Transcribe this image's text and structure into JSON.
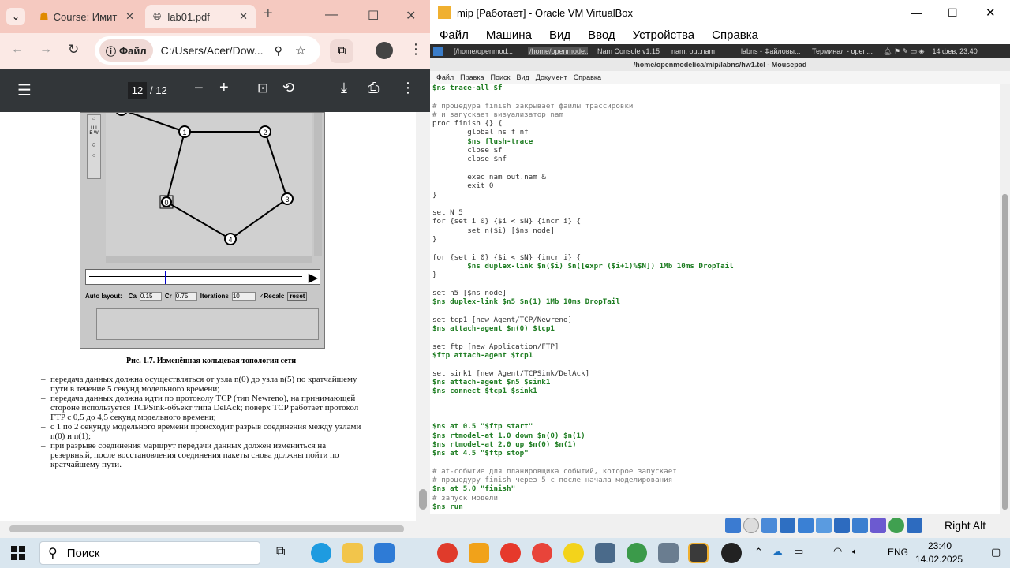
{
  "chrome": {
    "tabs": [
      {
        "label": "Course: Имит"
      },
      {
        "label": "lab01.pdf"
      }
    ],
    "new_tab": "+",
    "win_min": "—",
    "win_max": "☐",
    "win_close": "✕",
    "chip_label": "Файл",
    "url": "C:/Users/Acer/Dow...",
    "pdf": {
      "page_current": "12",
      "page_total": "/ 12"
    }
  },
  "pdf": {
    "nam_labels": {
      "autolayout": "Auto layout:",
      "ca": "Ca",
      "ca_val": "0.15",
      "cr": "Cr",
      "cr_val": "0.75",
      "iter": "Iterations",
      "iter_val": "10",
      "recalc": "✓Recalc",
      "reset": "reset"
    },
    "nodes": [
      "1",
      "2",
      "3",
      "4",
      "0"
    ],
    "caption": "Рис. 1.7. Изменённая кольцевая топология сети",
    "bullets": [
      "передача данных должна осуществляться от узла n(0) до узла n(5) по кратчайшему пути в течение 5 секунд модельного времени;",
      "передача данных должна идти по протоколу TCP (тип Newreno), на принимающей стороне используется TCPSink-объект типа DelAck; поверх TCP работает протокол FTP с 0,5 до 4,5 секунд модельного времени;",
      "с 1 по 2 секунду модельного времени происходит разрыв соединения между узлами n(0) и n(1);",
      "при разрыве соединения маршрут передачи данных должен измениться на резервный, после восстановления соединения пакеты снова должны пойти по кратчайшему пути."
    ]
  },
  "vbox": {
    "title": "mip [Работает] - Oracle VM VirtualBox",
    "menu": [
      "Файл",
      "Машина",
      "Вид",
      "Ввод",
      "Устройства",
      "Справка"
    ],
    "guest_tabs": [
      "[/home/openmod...",
      "/home/openmode...",
      "Nam Console v1.15",
      "nam: out.nam",
      "labns - Файловы...",
      "Терминал - open..."
    ],
    "guest_clock": "14 фев, 23:40",
    "mousepad_title": "/home/openmodelica/mip/labns/hw1.tcl - Mousepad",
    "mousepad_menu": [
      "Файл",
      "Правка",
      "Поиск",
      "Вид",
      "Документ",
      "Справка"
    ],
    "host_key": "Right Alt"
  },
  "code_lines": [
    "$ns trace-all $f",
    "",
    "# процедура finish закрывает файлы трассировки",
    "# и запускает визуализатор nam",
    "proc finish {} {",
    "        global ns f nf",
    "        $ns flush-trace",
    "        close $f",
    "        close $nf",
    "",
    "        exec nam out.nam &",
    "        exit 0",
    "}",
    "",
    "set N 5",
    "for {set i 0} {$i < $N} {incr i} {",
    "        set n($i) [$ns node]",
    "}",
    "",
    "for {set i 0} {$i < $N} {incr i} {",
    "        $ns duplex-link $n($i) $n([expr ($i+1)%$N]) 1Mb 10ms DropTail",
    "}",
    "",
    "set n5 [$ns node]",
    "$ns duplex-link $n5 $n(1) 1Mb 10ms DropTail",
    "",
    "set tcp1 [new Agent/TCP/Newreno]",
    "$ns attach-agent $n(0) $tcp1",
    "",
    "set ftp [new Application/FTP]",
    "$ftp attach-agent $tcp1",
    "",
    "set sink1 [new Agent/TCPSink/DelAck]",
    "$ns attach-agent $n5 $sink1",
    "$ns connect $tcp1 $sink1",
    "",
    "",
    "",
    "$ns at 0.5 \"$ftp start\"",
    "$ns rtmodel-at 1.0 down $n(0) $n(1)",
    "$ns rtmodel-at 2.0 up $n(0) $n(1)",
    "$ns at 4.5 \"$ftp stop\"",
    "",
    "# at-событие для планировщика событий, которое запускает",
    "# процедуру finish через 5 с после начала моделирования",
    "$ns at 5.0 \"finish\"",
    "# запуск модели",
    "$ns run"
  ],
  "taskbar": {
    "search_label": "Поиск",
    "lang": "ENG",
    "time": "23:40",
    "date": "14.02.2025"
  }
}
